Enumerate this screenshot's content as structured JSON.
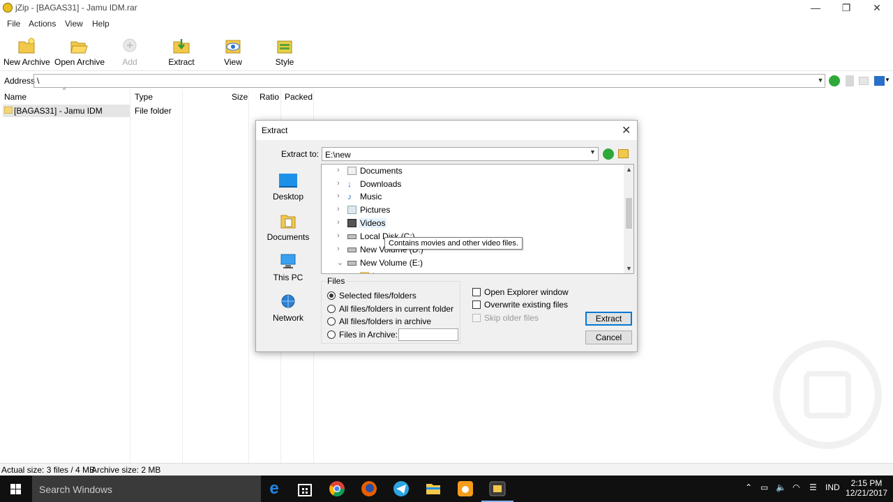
{
  "window": {
    "title": "jZip - [BAGAS31] - Jamu IDM.rar",
    "minimize": "—",
    "restore": "❐",
    "close": "✕"
  },
  "menu": [
    "File",
    "Actions",
    "View",
    "Help"
  ],
  "toolbar": {
    "new_archive": "New Archive",
    "open_archive": "Open Archive",
    "add": "Add",
    "extract": "Extract",
    "view": "View",
    "style": "Style"
  },
  "address": {
    "label": "Address",
    "value": "\\"
  },
  "list": {
    "columns": {
      "name": "Name",
      "type": "Type",
      "size": "Size",
      "ratio": "Ratio",
      "packed": "Packed"
    },
    "rows": [
      {
        "name": "[BAGAS31] - Jamu IDM",
        "type": "File folder"
      }
    ]
  },
  "status": {
    "actual": "Actual size: 3 files / 4 MB",
    "archive": "Archive size: 2 MB"
  },
  "dialog": {
    "title": "Extract",
    "extract_to_label": "Extract to:",
    "extract_to_value": "E:\\new",
    "places": [
      "Desktop",
      "Documents",
      "This PC",
      "Network"
    ],
    "tree": [
      {
        "label": "Documents",
        "arrow": "›"
      },
      {
        "label": "Downloads",
        "arrow": "›"
      },
      {
        "label": "Music",
        "arrow": "›"
      },
      {
        "label": "Pictures",
        "arrow": "›"
      },
      {
        "label": "Videos",
        "arrow": "›"
      },
      {
        "label": "Local Disk (C:)",
        "arrow": "›"
      },
      {
        "label": "New Volume (D:)",
        "arrow": "›"
      },
      {
        "label": "New Volume (E:)",
        "arrow": "⌄"
      },
      {
        "label": "bounty",
        "arrow": ""
      }
    ],
    "tooltip": "Contains movies and other video files.",
    "files_group": "Files",
    "radios": [
      {
        "label": "Selected files/folders",
        "checked": true
      },
      {
        "label": "All files/folders in current folder",
        "checked": false
      },
      {
        "label": "All files/folders in archive",
        "checked": false
      },
      {
        "label": "Files in Archive:",
        "checked": false
      }
    ],
    "checks": [
      {
        "label": "Open Explorer window",
        "checked": false,
        "disabled": false
      },
      {
        "label": "Overwrite existing files",
        "checked": false,
        "disabled": false
      },
      {
        "label": "Skip older files",
        "checked": false,
        "disabled": true
      }
    ],
    "extract_button": "Extract",
    "cancel_button": "Cancel"
  },
  "taskbar": {
    "search": "Search Windows",
    "lang": "IND",
    "time": "2:15 PM",
    "date": "12/21/2017"
  },
  "colors": {
    "accent": "#0078d7",
    "taskbar": "#101010",
    "folder": "#f4d67a"
  }
}
